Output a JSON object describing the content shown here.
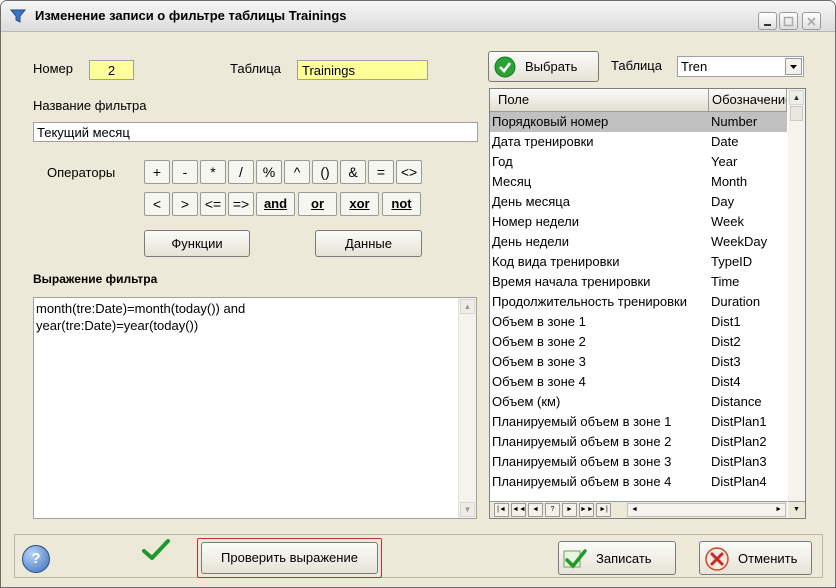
{
  "window": {
    "title": "Изменение записи о фильтре таблицы Trainings"
  },
  "form": {
    "number_label": "Номер",
    "number_value": "2",
    "table_label": "Таблица",
    "table_value": "Trainings",
    "filter_name_label": "Название фильтра",
    "filter_name_value": "Текущий месяц",
    "operators_label": "Операторы",
    "operators_row1": [
      "+",
      "-",
      "*",
      "/",
      "%",
      "^",
      "()",
      "&",
      "=",
      "<>"
    ],
    "operators_row2": [
      "<",
      ">",
      "<=",
      "=>",
      "and",
      "or",
      "xor",
      "not"
    ],
    "functions_button": "Функции",
    "data_button": "Данные",
    "expression_label": "Выражение фильтра",
    "expression_line1": "month(tre:Date)=month(today()) and",
    "expression_line2": "year(tre:Date)=year(today())"
  },
  "right": {
    "select_button": "Выбрать",
    "table_label": "Таблица",
    "table_dropdown_value": "Tren",
    "grid_headers": [
      "Поле",
      "Обозначение"
    ],
    "rows": [
      [
        "Порядковый номер",
        "Number"
      ],
      [
        "Дата тренировки",
        "Date"
      ],
      [
        "Год",
        "Year"
      ],
      [
        "Месяц",
        "Month"
      ],
      [
        "День месяца",
        "Day"
      ],
      [
        "Номер недели",
        "Week"
      ],
      [
        "День недели",
        "WeekDay"
      ],
      [
        "Код вида тренировки",
        "TypeID"
      ],
      [
        "Время начала тренировки",
        "Time"
      ],
      [
        "Продолжительность тренировки",
        "Duration"
      ],
      [
        "Объем в зоне 1",
        "Dist1"
      ],
      [
        "Объем в зоне 2",
        "Dist2"
      ],
      [
        "Объем в зоне 3",
        "Dist3"
      ],
      [
        "Объем в зоне 4",
        "Dist4"
      ],
      [
        "Объем (км)",
        "Distance"
      ],
      [
        "Планируемый объем в зоне 1",
        "DistPlan1"
      ],
      [
        "Планируемый объем в зоне 2",
        "DistPlan2"
      ],
      [
        "Планируемый объем в зоне 3",
        "DistPlan3"
      ],
      [
        "Планируемый объем в зоне 4",
        "DistPlan4"
      ]
    ],
    "selected_row": 0,
    "nav_buttons": [
      "|◄",
      "◄◄",
      "◄",
      "?",
      "►",
      "►►",
      "►|"
    ]
  },
  "bottom": {
    "check_button": "Проверить выражение",
    "save_button": "Записать",
    "cancel_button": "Отменить"
  },
  "colors": {
    "field_yellow": "#ffff99",
    "selected_row": "#c0c0c0",
    "check_green": "#1f9a2a"
  }
}
